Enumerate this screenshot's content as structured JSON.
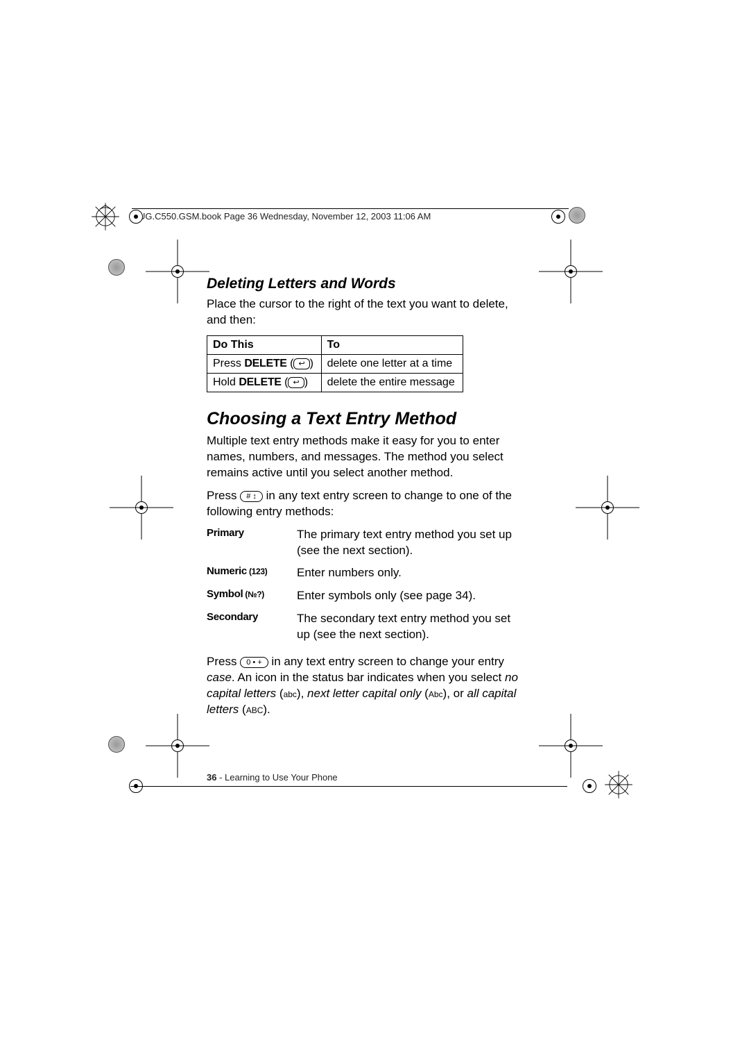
{
  "header": {
    "running": "UG.C550.GSM.book  Page 36  Wednesday, November 12, 2003  11:06 AM"
  },
  "section1": {
    "heading": "Deleting Letters and Words",
    "intro": "Place the cursor to the right of the text you want to delete, and then:"
  },
  "table": {
    "col1": "Do This",
    "col2": "To",
    "rows": [
      {
        "do_prefix": "Press ",
        "do_key": "DELETE",
        "do_suffix": " (",
        "do_icon": "↩",
        "do_close": ")",
        "to": "delete one letter at a time"
      },
      {
        "do_prefix": "Hold ",
        "do_key": "DELETE",
        "do_suffix": " (",
        "do_icon": "↩",
        "do_close": ")",
        "to": "delete the entire message"
      }
    ]
  },
  "section2": {
    "heading": "Choosing a Text Entry Method",
    "para1": "Multiple text entry methods make it easy for you to enter names, numbers, and messages. The method you select remains active until you select another method.",
    "para2_a": "Press ",
    "para2_key": "# ↕",
    "para2_b": " in any text entry screen to change to one of the following entry methods:",
    "methods": [
      {
        "term": "Primary",
        "suffix": "",
        "def": "The primary text entry method you set up (see the next section)."
      },
      {
        "term": "Numeric",
        "suffix": " (123)",
        "def": "Enter numbers only."
      },
      {
        "term": "Symbol",
        "suffix": " (№?)",
        "def": "Enter symbols only (see page 34)."
      },
      {
        "term": "Secondary",
        "suffix": "",
        "def": "The secondary text entry method you set up (see the next section)."
      }
    ],
    "para3_a": "Press ",
    "para3_key": "0 • +",
    "para3_b": " in any text entry screen to change your entry ",
    "para3_c": "case",
    "para3_d": ". An icon in the status bar indicates when you select ",
    "para3_e": "no capital letters",
    "para3_f": " (",
    "para3_g": "abc",
    "para3_h": "), ",
    "para3_i": "next letter capital only",
    "para3_j": " (",
    "para3_k": "Abc",
    "para3_l": "), or ",
    "para3_m": "all capital letters",
    "para3_n": " (",
    "para3_o": "ABC",
    "para3_p": ")."
  },
  "footer": {
    "page_no": "36",
    "sep": " - ",
    "chapter": "Learning to Use Your Phone"
  }
}
